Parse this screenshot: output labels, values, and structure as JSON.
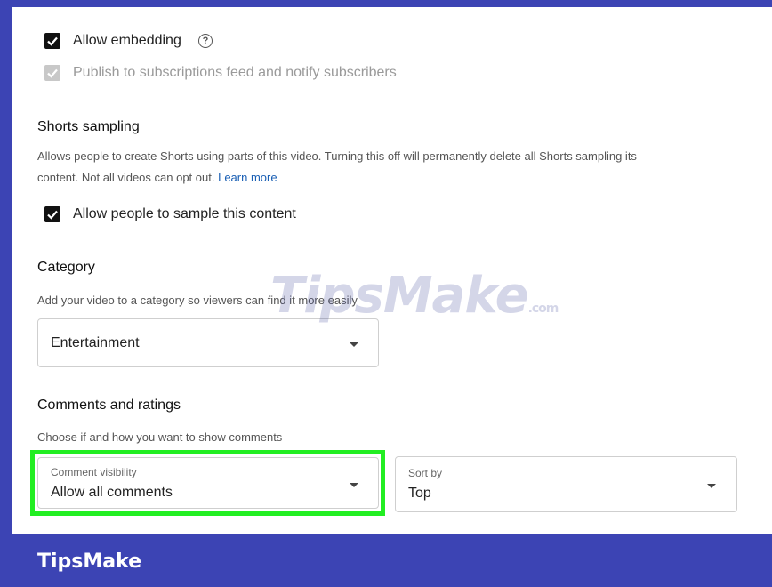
{
  "embedding": {
    "label": "Allow embedding",
    "checked": true
  },
  "publish_feed": {
    "label": "Publish to subscriptions feed and notify subscribers",
    "checked": true,
    "disabled": true
  },
  "shorts": {
    "heading": "Shorts sampling",
    "desc_line1": "Allows people to create Shorts using parts of this video. Turning this off will permanently delete all Shorts sampling its",
    "desc_line2": "content. Not all videos can opt out.",
    "learn_more": "Learn more",
    "checkbox_label": "Allow people to sample this content",
    "checked": true
  },
  "category": {
    "heading": "Category",
    "desc": "Add your video to a category so viewers can find it more easily",
    "selected": "Entertainment"
  },
  "comments": {
    "heading": "Comments and ratings",
    "desc": "Choose if and how you want to show comments",
    "visibility_label": "Comment visibility",
    "visibility_value": "Allow all comments",
    "sort_label": "Sort by",
    "sort_value": "Top"
  },
  "watermark": {
    "main": "TipsMake",
    "suffix": ".com"
  },
  "brand": "TipsMake",
  "colors": {
    "frame": "#3c44b4",
    "highlight": "#22ee22",
    "link": "#1a5fb4"
  }
}
